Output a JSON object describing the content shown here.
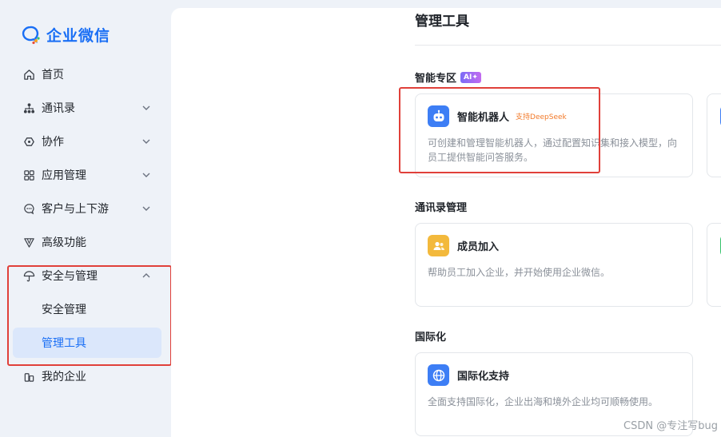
{
  "app": {
    "name": "企业微信"
  },
  "sidebar": {
    "items": [
      {
        "label": "首页",
        "icon": "home-icon"
      },
      {
        "label": "通讯录",
        "icon": "org-chart-icon"
      },
      {
        "label": "协作",
        "icon": "collab-icon"
      },
      {
        "label": "应用管理",
        "icon": "apps-grid-icon"
      },
      {
        "label": "客户与上下游",
        "icon": "chat-bubble-icon"
      },
      {
        "label": "高级功能",
        "icon": "premium-icon"
      },
      {
        "label": "安全与管理",
        "icon": "umbrella-icon",
        "expanded": true
      },
      {
        "label": "安全管理",
        "sub": true
      },
      {
        "label": "管理工具",
        "sub": true,
        "active": true
      },
      {
        "label": "我的企业",
        "icon": "building-icon"
      }
    ]
  },
  "main": {
    "title": "管理工具",
    "sections": [
      {
        "title": "智能专区",
        "badge": "AI✦",
        "cards": [
          {
            "title": "智能机器人",
            "tag": "支持DeepSeek",
            "desc": "可创建和管理智能机器人，通过配置知识集和接入模型，向员工提供智能问答服务。",
            "icon": "robot-icon",
            "icon_color": "#3d7ef5"
          }
        ]
      },
      {
        "title": "通讯录管理",
        "cards": [
          {
            "title": "成员加入",
            "desc": "帮助员工加入企业，并开始使用企业微信。",
            "icon": "members-icon",
            "icon_color": "#f3b93c"
          }
        ]
      },
      {
        "title": "国际化",
        "cards": [
          {
            "title": "国际化支持",
            "desc": "全面支持国际化，企业出海和境外企业均可顺畅使用。",
            "icon": "globe-icon",
            "icon_color": "#3d7ef5"
          }
        ]
      }
    ]
  },
  "watermark": "CSDN @专注写bug",
  "colors": {
    "accent": "#1a6ff5",
    "highlight_box": "#e0403a",
    "active_bg": "#dbe7fb"
  }
}
